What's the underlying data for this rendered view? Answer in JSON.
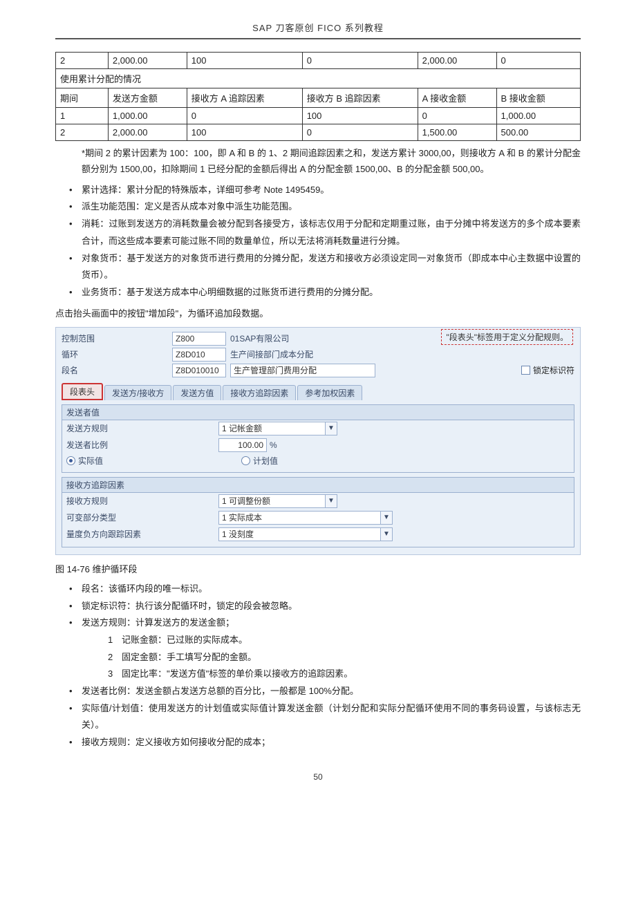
{
  "header": {
    "title": "SAP 刀客原创 FICO 系列教程"
  },
  "table1": {
    "row0": {
      "c0": "2",
      "c1": "2,000.00",
      "c2": "100",
      "c3": "0",
      "c4": "2,000.00",
      "c5": "0"
    },
    "section_title": "使用累计分配的情况",
    "header_row": {
      "c0": "期间",
      "c1": "发送方金额",
      "c2": "接收方 A 追踪因素",
      "c3": "接收方 B 追踪因素",
      "c4": "A 接收金额",
      "c5": "B 接收金额"
    },
    "row1": {
      "c0": "1",
      "c1": "1,000.00",
      "c2": "0",
      "c3": "100",
      "c4": "0",
      "c5": "1,000.00"
    },
    "row2": {
      "c0": "2",
      "c1": "2,000.00",
      "c2": "100",
      "c3": "0",
      "c4": "1,500.00",
      "c5": "500.00"
    }
  },
  "para1": "*期间 2 的累计因素为 100：100，即 A 和 B 的 1、2 期间追踪因素之和，发送方累计 3000,00，则接收方 A 和 B 的累计分配金额分别为 1500,00，扣除期间 1 已经分配的金额后得出 A 的分配金额 1500,00、B 的分配金额 500,00。",
  "bullets1": {
    "b0": "累计选择：累计分配的特殊版本，详细可参考 Note 1495459。",
    "b1": "派生功能范围：定义是否从成本对象中派生功能范围。",
    "b2": "消耗：过账到发送方的消耗数量会被分配到各接受方，该标志仅用于分配和定期重过账，由于分摊中将发送方的多个成本要素合计，而这些成本要素可能过账不同的数量单位，所以无法将消耗数量进行分摊。",
    "b3": "对象货币：基于发送方的对象货币进行费用的分摊分配，发送方和接收方必须设定同一对象货币（即成本中心主数据中设置的货币）。",
    "b4": "业务货币：基于发送方成本中心明细数据的过账货币进行费用的分摊分配。"
  },
  "para2": "点击抬头画面中的按钮\"增加段\"，为循环追加段数据。",
  "sap": {
    "callout": "\"段表头\"标签用于定义分配规则。",
    "r0": {
      "label": "控制范围",
      "value": "Z800",
      "desc": "01SAP有限公司"
    },
    "r1": {
      "label": "循环",
      "value": "Z8D010",
      "desc": "生产间接部门成本分配"
    },
    "r2": {
      "label": "段名",
      "value": "Z8D010010",
      "desc": "生产管理部门费用分配",
      "lock": "锁定标识符"
    },
    "tabs": {
      "t0": "段表头",
      "t1": "发送方/接收方",
      "t2": "发送方值",
      "t3": "接收方追踪因素",
      "t4": "参考加权因素"
    },
    "g1": {
      "title": "发送者值",
      "f0": {
        "label": "发送方规则",
        "value": "1 记帐金额"
      },
      "f1": {
        "label": "发送者比例",
        "value": "100.00",
        "unit": "%"
      },
      "radio0": "实际值",
      "radio1": "计划值"
    },
    "g2": {
      "title": "接收方追踪因素",
      "f0": {
        "label": "接收方规则",
        "value": "1 可调整份额"
      },
      "f1": {
        "label": "可变部分类型",
        "value": "1 实际成本"
      },
      "f2": {
        "label": "量度负方向跟踪因素",
        "value": "1 没刻度"
      }
    }
  },
  "figure_caption": "图 14-76 维护循环段",
  "bullets2": {
    "b0": "段名：该循环内段的唯一标识。",
    "b1": "锁定标识符：执行该分配循环时，锁定的段会被忽略。",
    "b2": "发送方规则：计算发送方的发送金额；",
    "nums": {
      "n1": {
        "num": "1",
        "text": "记账金额：已过账的实际成本。"
      },
      "n2": {
        "num": "2",
        "text": "固定金额：手工填写分配的金额。"
      },
      "n3": {
        "num": "3",
        "text": "固定比率：\"发送方值\"标签的单价乘以接收方的追踪因素。"
      }
    },
    "b3": "发送者比例：发送金额占发送方总额的百分比，一般都是 100%分配。",
    "b4": "实际值/计划值：使用发送方的计划值或实际值计算发送金额（计划分配和实际分配循环使用不同的事务码设置，与该标志无关）。",
    "b5": "接收方规则：定义接收方如何接收分配的成本；"
  },
  "page_number": "50"
}
